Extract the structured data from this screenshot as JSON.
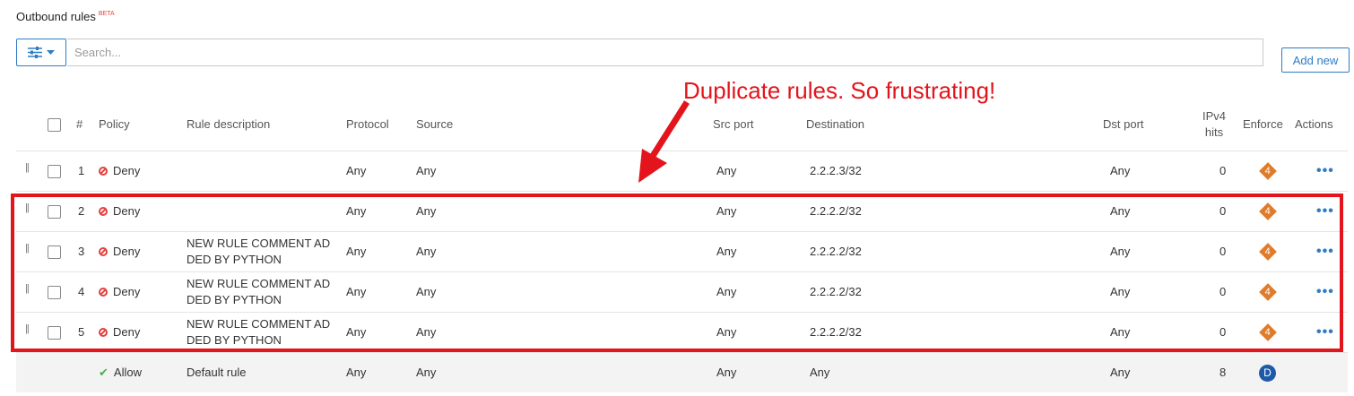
{
  "page": {
    "title": "Outbound rules",
    "beta_label": "BETA"
  },
  "toolbar": {
    "search_placeholder": "Search...",
    "add_label": "Add new"
  },
  "icons": {
    "filter": "sliders-icon",
    "dropdown": "caret-down-icon",
    "drag": "drag-handle-icon",
    "deny": "ban-icon",
    "allow": "check-icon",
    "more": "ellipsis-icon"
  },
  "colors": {
    "accent": "#2e7cc4",
    "deny": "#e5413e",
    "allow": "#4caf50",
    "enforce": "#e07b2a",
    "default_badge": "#1e5aa8",
    "annotation": "#e3141b"
  },
  "headers": {
    "num": "#",
    "policy": "Policy",
    "description": "Rule description",
    "protocol": "Protocol",
    "source": "Source",
    "src_port": "Src port",
    "destination": "Destination",
    "dst_port": "Dst port",
    "ipv4_hits_line1": "IPv4",
    "ipv4_hits_line2": "hits",
    "enforce": "Enforce",
    "actions": "Actions"
  },
  "rules": [
    {
      "num": "1",
      "policy": "Deny",
      "desc_line1": "",
      "desc_line2": "",
      "protocol": "Any",
      "source": "Any",
      "src_port": "Any",
      "destination": "2.2.2.3/32",
      "dst_port": "Any",
      "hits": "0",
      "enforce": "4"
    },
    {
      "num": "2",
      "policy": "Deny",
      "desc_line1": "",
      "desc_line2": "",
      "protocol": "Any",
      "source": "Any",
      "src_port": "Any",
      "destination": "2.2.2.2/32",
      "dst_port": "Any",
      "hits": "0",
      "enforce": "4"
    },
    {
      "num": "3",
      "policy": "Deny",
      "desc_line1": "NEW RULE COMMENT AD",
      "desc_line2": "DED BY PYTHON",
      "protocol": "Any",
      "source": "Any",
      "src_port": "Any",
      "destination": "2.2.2.2/32",
      "dst_port": "Any",
      "hits": "0",
      "enforce": "4"
    },
    {
      "num": "4",
      "policy": "Deny",
      "desc_line1": "NEW RULE COMMENT AD",
      "desc_line2": "DED BY PYTHON",
      "protocol": "Any",
      "source": "Any",
      "src_port": "Any",
      "destination": "2.2.2.2/32",
      "dst_port": "Any",
      "hits": "0",
      "enforce": "4"
    },
    {
      "num": "5",
      "policy": "Deny",
      "desc_line1": "NEW RULE COMMENT AD",
      "desc_line2": "DED BY PYTHON",
      "protocol": "Any",
      "source": "Any",
      "src_port": "Any",
      "destination": "2.2.2.2/32",
      "dst_port": "Any",
      "hits": "0",
      "enforce": "4"
    }
  ],
  "default_rule": {
    "policy": "Allow",
    "description": "Default rule",
    "protocol": "Any",
    "source": "Any",
    "src_port": "Any",
    "destination": "Any",
    "dst_port": "Any",
    "hits": "8",
    "enforce": "D"
  },
  "annotation": {
    "text": "Duplicate rules. So frustrating!"
  }
}
